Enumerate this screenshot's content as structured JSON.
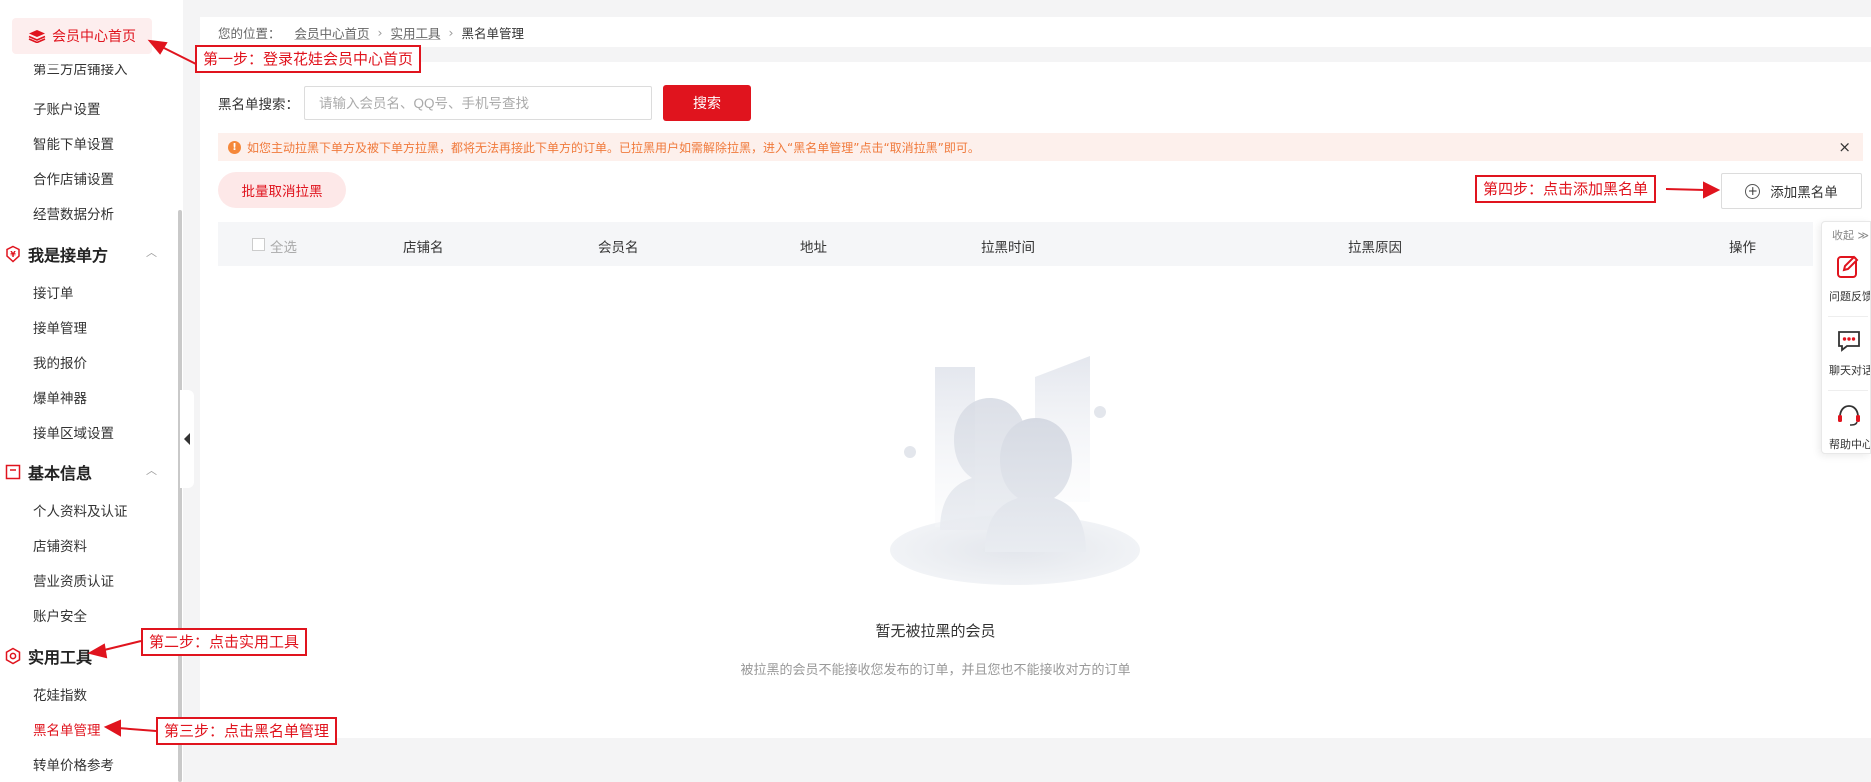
{
  "sidebar": {
    "home_label": "会员中心首页",
    "partial_item": "第三方店铺接入",
    "items_top": [
      "子账户设置",
      "智能下单设置",
      "合作店铺设置",
      "经营数据分析"
    ],
    "group_receive": {
      "title": "我是接单方",
      "items": [
        "接订单",
        "接单管理",
        "我的报价",
        "爆单神器",
        "接单区域设置"
      ]
    },
    "group_basic": {
      "title": "基本信息",
      "items": [
        "个人资料及认证",
        "店铺资料",
        "营业资质认证",
        "账户安全"
      ]
    },
    "group_tools": {
      "title": "实用工具",
      "items": [
        "花娃指数",
        "黑名单管理",
        "转单价格参考"
      ]
    }
  },
  "breadcrumb": {
    "prefix": "您的位置：",
    "home": "会员中心首页",
    "tools": "实用工具",
    "current": "黑名单管理"
  },
  "search": {
    "label": "黑名单搜索：",
    "placeholder": "请输入会员名、QQ号、手机号查找",
    "button": "搜索"
  },
  "notice": {
    "text": "如您主动拉黑下单方及被下单方拉黑，都将无法再接此下单方的订单。已拉黑用户如需解除拉黑，进入“黑名单管理”点击“取消拉黑”即可。",
    "close": "×"
  },
  "actions": {
    "bulk": "批量取消拉黑",
    "add": "添加黑名单"
  },
  "table": {
    "select_all": "全选",
    "columns": [
      "店铺名",
      "会员名",
      "地址",
      "拉黑时间",
      "拉黑原因",
      "操作"
    ]
  },
  "empty": {
    "title": "暂无被拉黑的会员",
    "subtitle": "被拉黑的会员不能接收您发布的订单，并且您也不能接收对方的订单"
  },
  "float": {
    "fold": "收起 ≫",
    "items": [
      "问题反馈",
      "聊天对话",
      "帮助中心"
    ]
  },
  "annotations": {
    "step1": "第一步：登录花娃会员中心首页",
    "step2": "第二步：点击实用工具",
    "step3": "第三步：点击黑名单管理",
    "step4": "第四步：点击添加黑名单"
  },
  "colors": {
    "brand": "#e0141e",
    "notice_bg": "#fdf0ec",
    "notice_text": "#f07a3c"
  }
}
